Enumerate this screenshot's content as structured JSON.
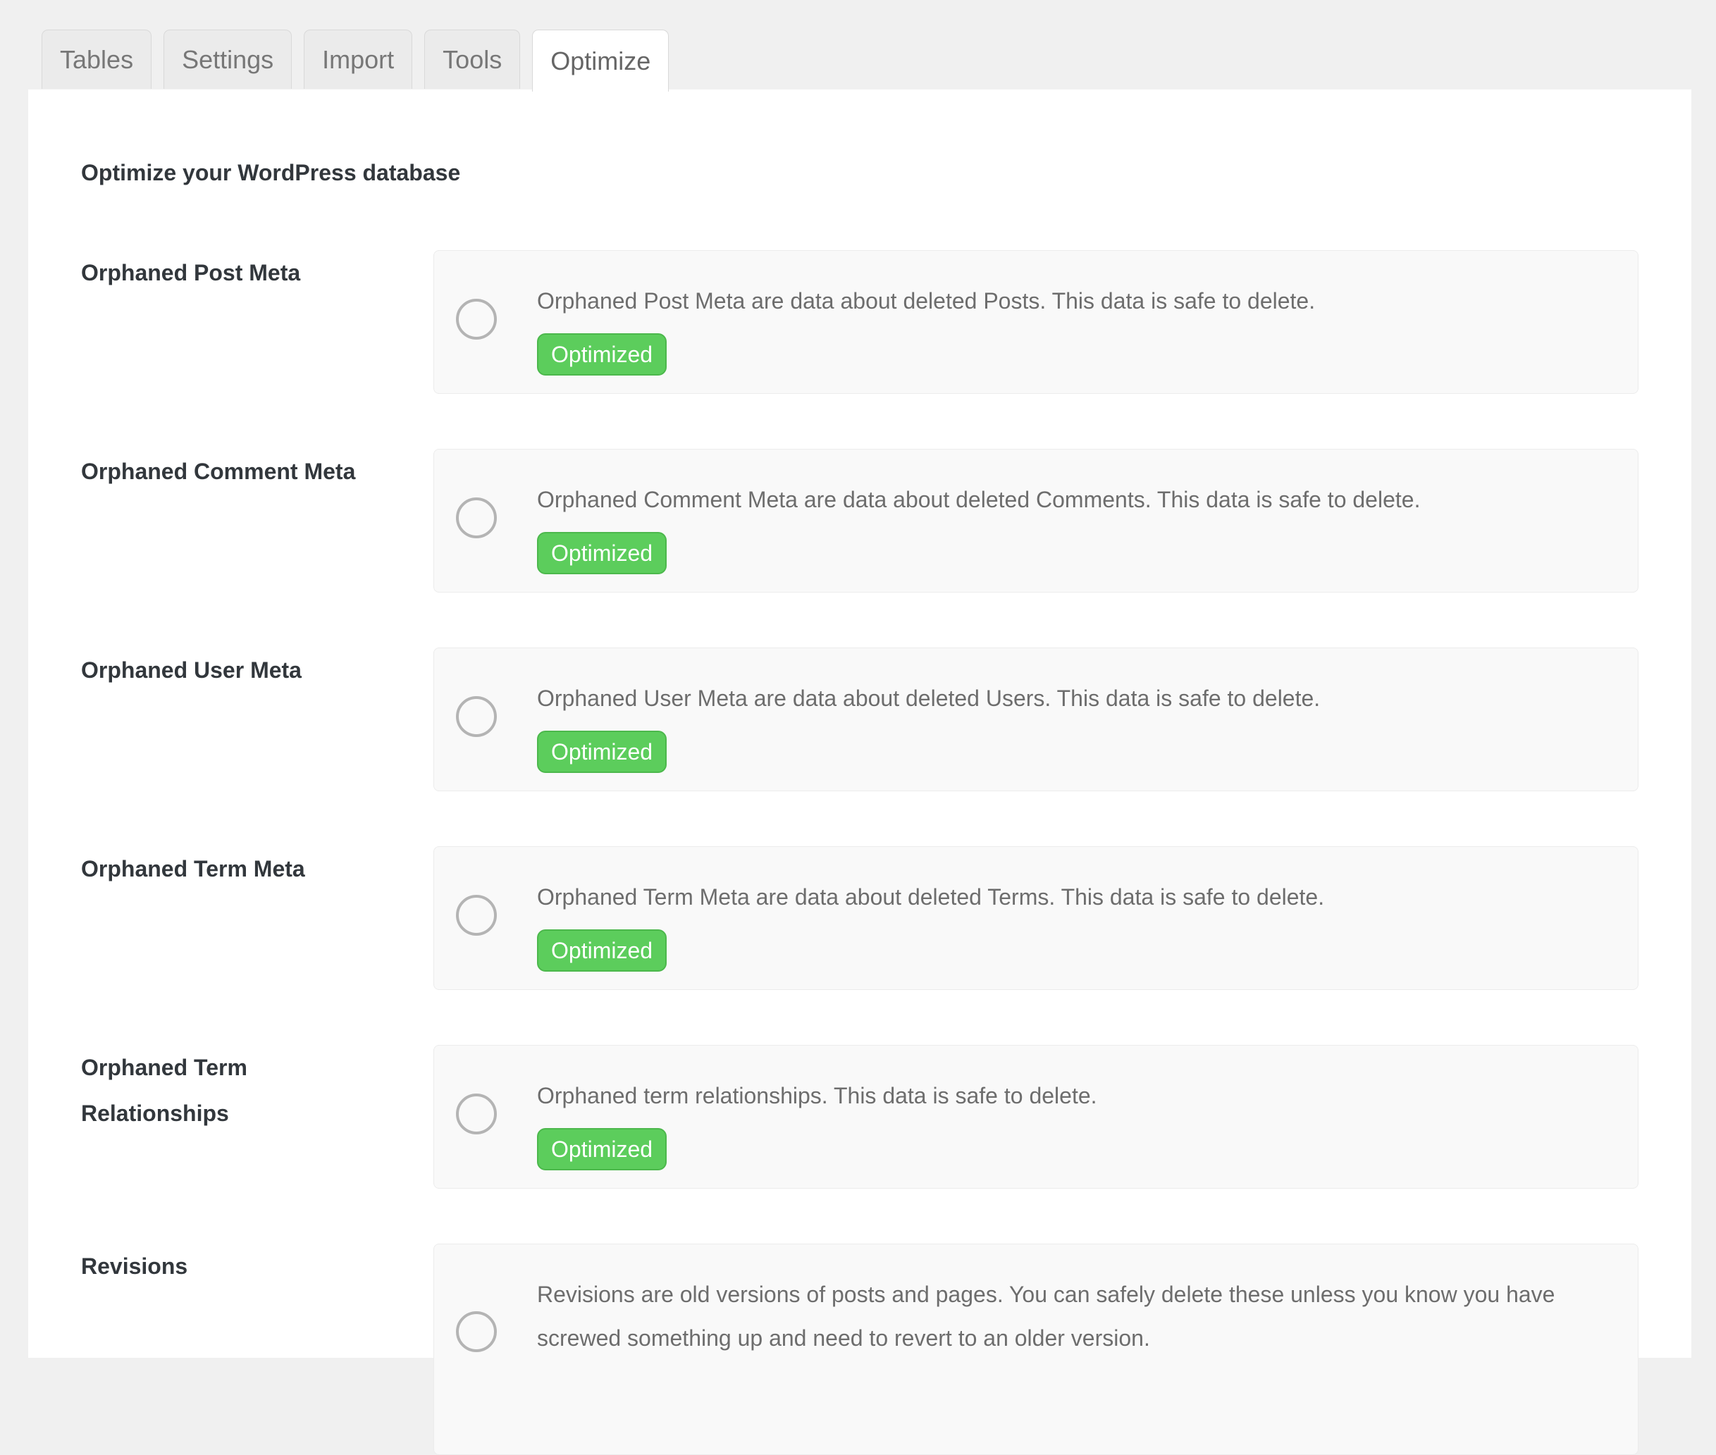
{
  "tabs": [
    {
      "label": "Tables",
      "active": false
    },
    {
      "label": "Settings",
      "active": false
    },
    {
      "label": "Import",
      "active": false
    },
    {
      "label": "Tools",
      "active": false
    },
    {
      "label": "Optimize",
      "active": true
    }
  ],
  "page": {
    "heading": "Optimize your WordPress database"
  },
  "rows": [
    {
      "label": "Orphaned Post Meta",
      "description": "Orphaned Post Meta are data about deleted Posts. This data is safe to delete.",
      "status": "Optimized"
    },
    {
      "label": "Orphaned Comment Meta",
      "description": "Orphaned Comment Meta are data about deleted Comments. This data is safe to delete.",
      "status": "Optimized"
    },
    {
      "label": "Orphaned User Meta",
      "description": "Orphaned User Meta are data about deleted Users. This data is safe to delete.",
      "status": "Optimized"
    },
    {
      "label": "Orphaned Term Meta",
      "description": "Orphaned Term Meta are data about deleted Terms. This data is safe to delete.",
      "status": "Optimized"
    },
    {
      "label": "Orphaned Term Relationships",
      "description": "Orphaned term relationships. This data is safe to delete.",
      "status": "Optimized"
    },
    {
      "label": "Revisions",
      "description": "Revisions are old versions of posts and pages. You can safely delete these unless you know you have screwed something up and need to revert to an older version."
    }
  ],
  "colors": {
    "badge_green": "#5ccd5c",
    "page_background": "#f0f0f0",
    "card_background": "#f9f9f9"
  },
  "icons": {
    "row_selector": "radio-circle-icon"
  }
}
